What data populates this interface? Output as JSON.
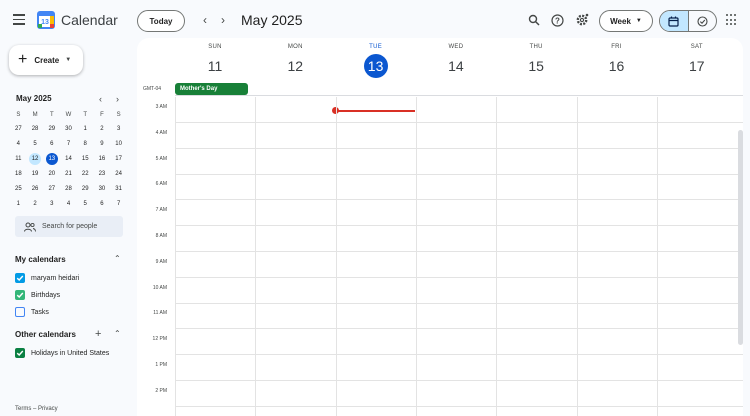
{
  "header": {
    "app_title": "Calendar",
    "logo_number": "13",
    "today_label": "Today",
    "prev_label": "‹",
    "next_label": "›",
    "month_title": "May 2025",
    "view_label": "Week"
  },
  "sidebar": {
    "create_label": "Create",
    "mini_month": "May 2025",
    "mini_dow": [
      "S",
      "M",
      "T",
      "W",
      "T",
      "F",
      "S"
    ],
    "mini_days": [
      [
        "27",
        "28",
        "29",
        "30",
        "1",
        "2",
        "3"
      ],
      [
        "4",
        "5",
        "6",
        "7",
        "8",
        "9",
        "10"
      ],
      [
        "11",
        "12",
        "13",
        "14",
        "15",
        "16",
        "17"
      ],
      [
        "18",
        "19",
        "20",
        "21",
        "22",
        "23",
        "24"
      ],
      [
        "25",
        "26",
        "27",
        "28",
        "29",
        "30",
        "31"
      ],
      [
        "1",
        "2",
        "3",
        "4",
        "5",
        "6",
        "7"
      ]
    ],
    "mini_selected": "12",
    "mini_today": "13",
    "search_people": "Search for people",
    "my_calendars_title": "My calendars",
    "my_calendars": [
      {
        "label": "maryam heidari",
        "color": "#039be5",
        "checked": true
      },
      {
        "label": "Birthdays",
        "color": "#33b679",
        "checked": true
      },
      {
        "label": "Tasks",
        "color": "#4285f4",
        "checked": false
      }
    ],
    "other_calendars_title": "Other calendars",
    "other_calendars": [
      {
        "label": "Holidays in United States",
        "color": "#0b8043",
        "checked": true
      }
    ],
    "terms": "Terms – Privacy"
  },
  "week": {
    "timezone": "GMT-04",
    "days": [
      {
        "dow": "SUN",
        "num": "11"
      },
      {
        "dow": "MON",
        "num": "12"
      },
      {
        "dow": "TUE",
        "num": "13"
      },
      {
        "dow": "WED",
        "num": "14"
      },
      {
        "dow": "THU",
        "num": "15"
      },
      {
        "dow": "FRI",
        "num": "16"
      },
      {
        "dow": "SAT",
        "num": "17"
      }
    ],
    "today_index": 2,
    "all_day_event": {
      "title": "Mother's Day",
      "color": "#188038",
      "day_index": 0
    },
    "hours": [
      "3 AM",
      "4 AM",
      "5 AM",
      "6 AM",
      "7 AM",
      "8 AM",
      "9 AM",
      "10 AM",
      "11 AM",
      "12 PM",
      "1 PM",
      "2 PM"
    ]
  },
  "colors": {
    "accent": "#0b57d0",
    "now_indicator": "#d93025",
    "selected_view": "#c2e7ff"
  }
}
